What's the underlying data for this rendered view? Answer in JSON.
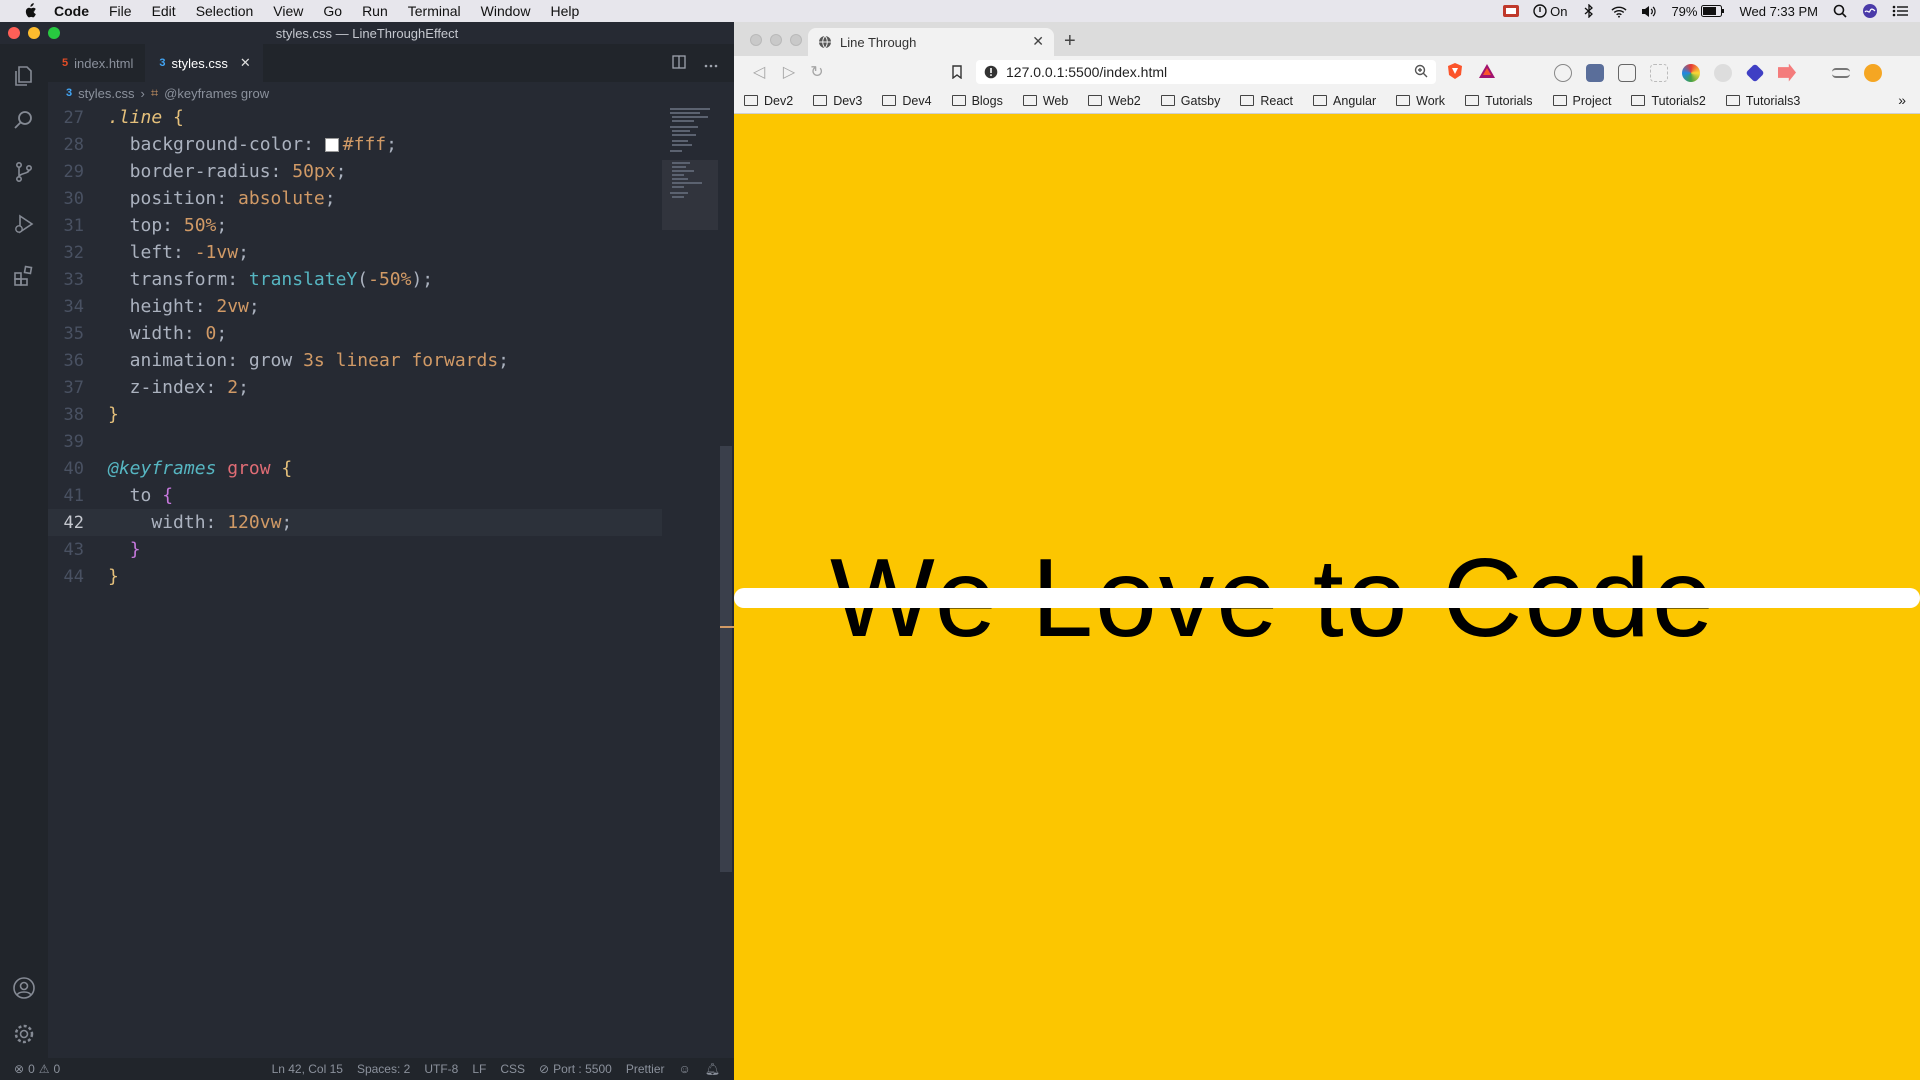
{
  "menubar": {
    "items": [
      "Code",
      "File",
      "Edit",
      "Selection",
      "View",
      "Go",
      "Run",
      "Terminal",
      "Window",
      "Help"
    ],
    "right": {
      "focus": "On",
      "battery": "79%",
      "clock": "Wed 7:33 PM"
    }
  },
  "vscode": {
    "window_title": "styles.css — LineThroughEffect",
    "tabs": [
      {
        "label": "index.html",
        "icon": "html5-icon"
      },
      {
        "label": "styles.css",
        "icon": "css3-icon"
      }
    ],
    "breadcrumb": {
      "file": "styles.css",
      "symbol": "@keyframes grow"
    },
    "code_lines": [
      {
        "n": "27",
        "code": ".line {"
      },
      {
        "n": "28",
        "code": "  background-color: #fff;"
      },
      {
        "n": "29",
        "code": "  border-radius: 50px;"
      },
      {
        "n": "30",
        "code": "  position: absolute;"
      },
      {
        "n": "31",
        "code": "  top: 50%;"
      },
      {
        "n": "32",
        "code": "  left: -1vw;"
      },
      {
        "n": "33",
        "code": "  transform: translateY(-50%);"
      },
      {
        "n": "34",
        "code": "  height: 2vw;"
      },
      {
        "n": "35",
        "code": "  width: 0;"
      },
      {
        "n": "36",
        "code": "  animation: grow 3s linear forwards;"
      },
      {
        "n": "37",
        "code": "  z-index: 2;"
      },
      {
        "n": "38",
        "code": "}"
      },
      {
        "n": "39",
        "code": ""
      },
      {
        "n": "40",
        "code": "@keyframes grow {"
      },
      {
        "n": "41",
        "code": "  to {"
      },
      {
        "n": "42",
        "code": "    width: 120vw;"
      },
      {
        "n": "43",
        "code": "  }"
      },
      {
        "n": "44",
        "code": "}"
      }
    ],
    "current_line": "42",
    "status": {
      "errors": "0",
      "warnings": "0",
      "position": "Ln 42, Col 15",
      "spaces": "Spaces: 2",
      "encoding": "UTF-8",
      "eol": "LF",
      "language": "CSS",
      "port": "Port : 5500",
      "formatter": "Prettier"
    }
  },
  "browser": {
    "tab_title": "Line Through",
    "url": "127.0.0.1:5500/index.html",
    "bookmarks": [
      "Dev2",
      "Dev3",
      "Dev4",
      "Blogs",
      "Web",
      "Web2",
      "Gatsby",
      "React",
      "Angular",
      "Work",
      "Tutorials",
      "Project",
      "Tutorials2",
      "Tutorials3"
    ],
    "page": {
      "headline": "We Love to Code",
      "background": "#fcc600",
      "strike_color": "#ffffff"
    }
  },
  "colors": {
    "editor_bg": "#262a33",
    "accent": "#fcc600"
  }
}
